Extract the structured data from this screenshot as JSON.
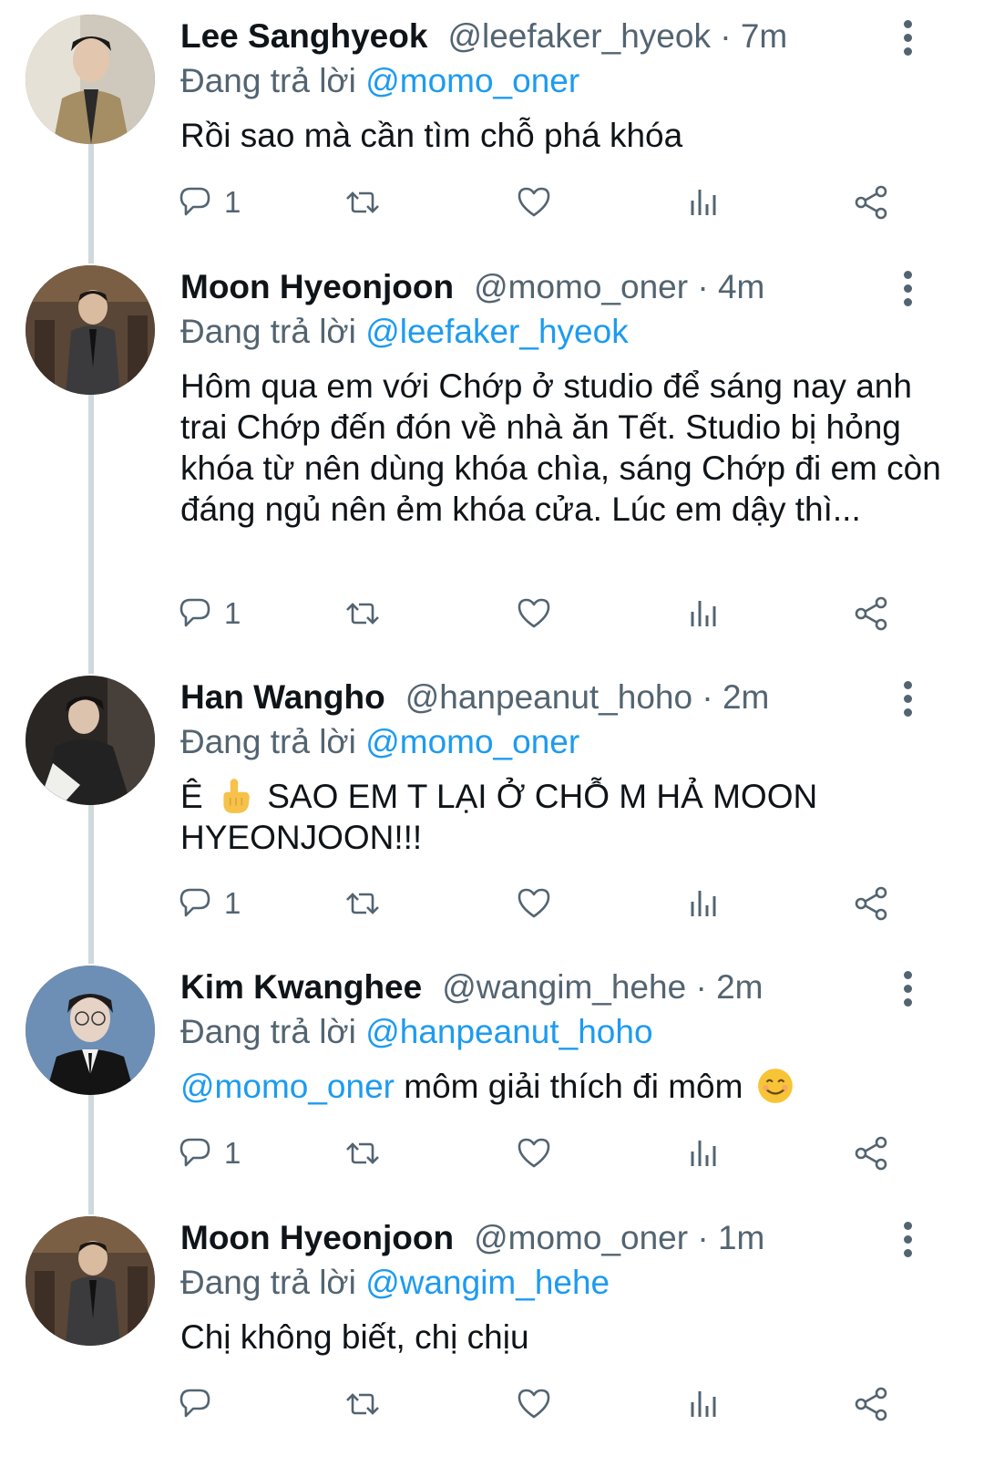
{
  "ui": {
    "separator": "·",
    "colors": {
      "accent": "#1d9bf0",
      "muted": "#536471",
      "text": "#0f1419",
      "thread_line": "#cfd9de"
    }
  },
  "tweets": [
    {
      "name": "Lee Sanghyeok",
      "handle": "@leefaker_hyeok",
      "time": "7m",
      "reply_prefix": "Đang trả lời",
      "reply_to": "@momo_oner",
      "text": "Rồi sao mà cần tìm chỗ phá khóa",
      "reply_count": "1",
      "icons": [
        "reply-icon",
        "retweet-icon",
        "like-icon",
        "views-icon",
        "share-icon",
        "more-icon"
      ]
    },
    {
      "name": "Moon Hyeonjoon",
      "handle": "@momo_oner",
      "time": "4m",
      "reply_prefix": "Đang trả lời",
      "reply_to": "@leefaker_hyeok",
      "text": "Hôm qua em với Chớp ở studio để sáng nay anh trai Chớp đến đón về nhà ăn Tết. Studio bị hỏng khóa từ nên dùng khóa chìa, sáng Chớp đi em còn đáng ngủ nên ẻm khóa cửa. Lúc em dậy thì...",
      "reply_count": "1"
    },
    {
      "name": "Han Wangho",
      "handle": "@hanpeanut_hoho",
      "time": "2m",
      "reply_prefix": "Đang trả lời",
      "reply_to": "@momo_oner",
      "text_before": "Ê",
      "emoji": "pointing-up-emoji",
      "text_after": "SAO EM T LẠI Ở CHỖ M HẢ MOON HYEONJOON!!!",
      "reply_count": "1"
    },
    {
      "name": "Kim Kwanghee",
      "handle": "@wangim_hehe",
      "time": "2m",
      "reply_prefix": "Đang trả lời",
      "reply_to": "@hanpeanut_hoho",
      "mention": "@momo_oner",
      "text": "môm giải thích đi môm",
      "emoji": "smiling-face-emoji",
      "reply_count": "1"
    },
    {
      "name": "Moon Hyeonjoon",
      "handle": "@momo_oner",
      "time": "1m",
      "reply_prefix": "Đang trả lời",
      "reply_to": "@wangim_hehe",
      "text": "Chị không biết, chị chịu",
      "reply_count": ""
    }
  ]
}
